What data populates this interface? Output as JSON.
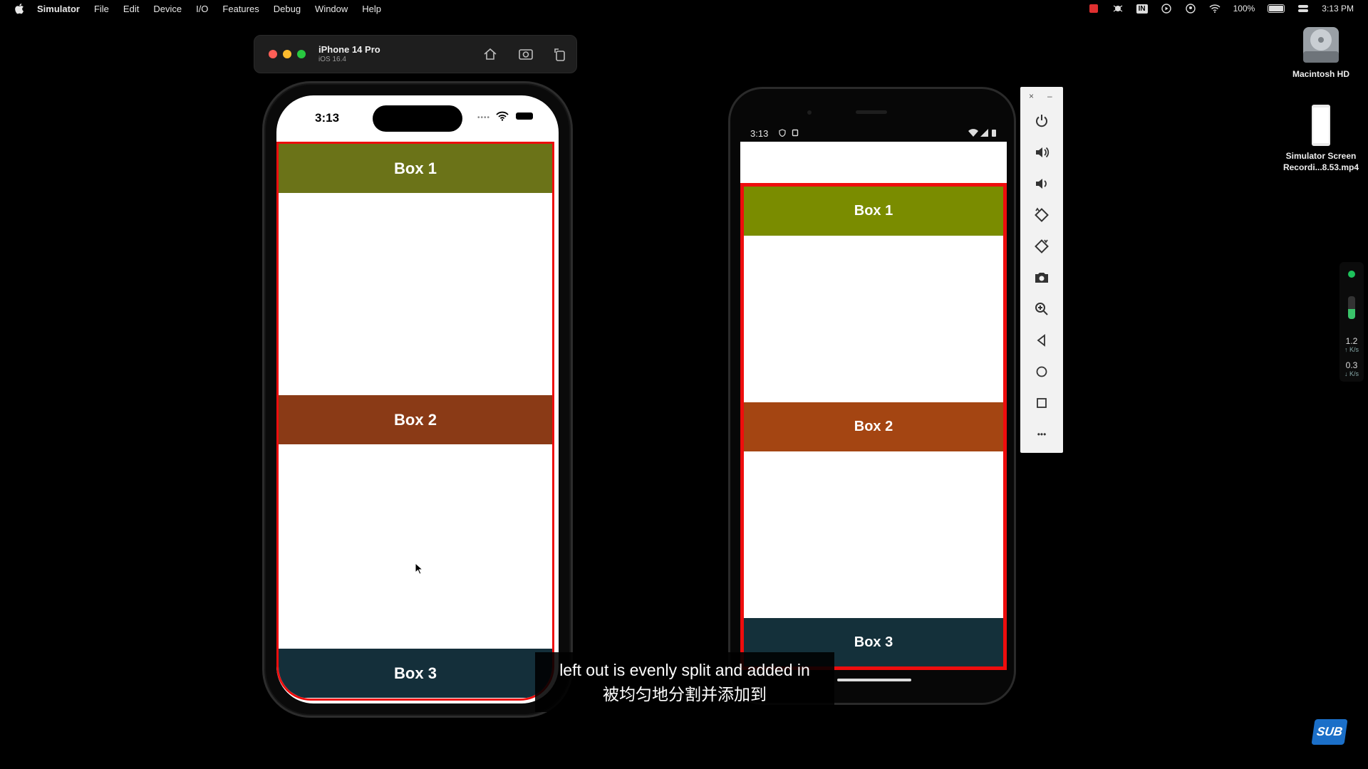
{
  "menubar": {
    "app": "Simulator",
    "items": [
      "File",
      "Edit",
      "Device",
      "I/O",
      "Features",
      "Debug",
      "Window",
      "Help"
    ],
    "in_badge": "IN",
    "battery_pct": "100%",
    "clock": "3:13 PM"
  },
  "sim_toolbar": {
    "device_name": "iPhone 14 Pro",
    "os": "iOS 16.4",
    "icons": [
      "home-icon",
      "screenshot-icon",
      "rotate-icon"
    ]
  },
  "iphone": {
    "time": "3:13",
    "dots": "••••",
    "boxes": [
      {
        "label": "Box 1",
        "color": "#6b7318"
      },
      {
        "label": "Box 2",
        "color": "#8a3a16"
      },
      {
        "label": "Box 3",
        "color": "#142f3a"
      }
    ],
    "border_color": "#ee0d0d"
  },
  "android": {
    "time": "3:13",
    "boxes": [
      {
        "label": "Box 1",
        "color": "#7a8c00"
      },
      {
        "label": "Box 2",
        "color": "#a44512"
      },
      {
        "label": "Box 3",
        "color": "#14303a"
      }
    ],
    "border_color": "#ee0d0d"
  },
  "emulator_panel": {
    "close": "×",
    "minimize": "–",
    "buttons": [
      "power-icon",
      "volume-up-icon",
      "volume-down-icon",
      "rotate-left-icon",
      "rotate-right-icon",
      "camera-icon",
      "zoom-icon",
      "back-icon",
      "home-icon",
      "overview-icon",
      "more-icon"
    ],
    "more": "•••"
  },
  "desktop": {
    "hd_label": "Macintosh HD",
    "recording_label_line1": "Simulator Screen",
    "recording_label_line2": "Recordi...8.53.mp4"
  },
  "net_widget": {
    "up_value": "1.2",
    "up_unit": "↑ K/s",
    "down_value": "0.3",
    "down_unit": "↓ K/s"
  },
  "subtitle": {
    "line1": "left out is evenly split and added in",
    "line2": "被均匀地分割并添加到"
  },
  "sub_logo": "SUB"
}
